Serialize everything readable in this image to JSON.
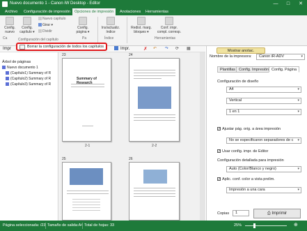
{
  "window": {
    "title": "Nuevo documento 1 - Canon iW Desktop - Editor",
    "min": "—",
    "max": "□",
    "close": "✕"
  },
  "ribbon_tabs": [
    "Archivo",
    "Configuración de impresión",
    "Opciones de impresión",
    "Anotaciones",
    "Herramientas"
  ],
  "ribbon": {
    "config_nuevo": "Config. nuevo",
    "config_capitulo": "Config. capítulo ▾",
    "nuevo_capitulo": "Nuevo capítulo",
    "girar": "Girar ▾",
    "dividir": "Dividir",
    "config_pagina": "Config. página ▾",
    "insertar_indice": "Ins/actualiz. índice",
    "indice_group": "Índice",
    "redistribuir": "Redist. marg. bloques ▾",
    "conf_impr": "Conf. impr. compl. corresp.",
    "herramientas_group": "Herramientas",
    "config_capitulo_group": "Configuración del capítulo",
    "ca": "Ca",
    "pa": "Pa"
  },
  "toolbar": {
    "impr": "Impr",
    "impr2": "Impr.",
    "mostrar_anotac": "Mostrar anotac."
  },
  "tooltip": {
    "text": "Borrar la configuración de todos los capítulos"
  },
  "tree": {
    "title": "Árbol de páginas",
    "root": "Nuevo documento 1",
    "items": [
      "(Capítulo1) Summary of R",
      "(Capítulo2) Summary of R",
      "(Capítulo3) Summary of R"
    ]
  },
  "pages": [
    {
      "num": "23",
      "label": "2-1",
      "heading": "Summary of Research"
    },
    {
      "num": "24",
      "label": "2-2",
      "heading": ""
    },
    {
      "num": "25",
      "label": "",
      "heading": ""
    },
    {
      "num": "26",
      "label": "",
      "heading": ""
    }
  ],
  "right": {
    "printer_label": "Nombre de la impresora:",
    "printer_value": "Canon iR-ADV",
    "tabs": [
      "Plantillas",
      "Config. Impresión",
      "Config. Página"
    ],
    "design_label": "Configuración de diseño",
    "size_value": "A4",
    "orientation_value": "Vertical",
    "layout_value": "1 en 1",
    "chk_ajustar": "Ajustar pág. orig. a área impresión",
    "separadores_value": "No se especificaron separadores de c",
    "chk_usar": "Usar config. impr. de Editor",
    "detail_label": "Configuración detallada para impresión",
    "color_value": "Auto (Color/Blanco y negro)",
    "chk_aplic": "Aplic. conf. color a vista prelim.",
    "sides_value": "Impresión a una cara",
    "copies_label": "Copias",
    "copies_value": "1",
    "print_button": "Imprimir"
  },
  "status": {
    "selected": "Página seleccionada: /23",
    "size": "Tamaño de salida:A4",
    "total": "Total de hojas: 33",
    "zoom": "25%"
  }
}
